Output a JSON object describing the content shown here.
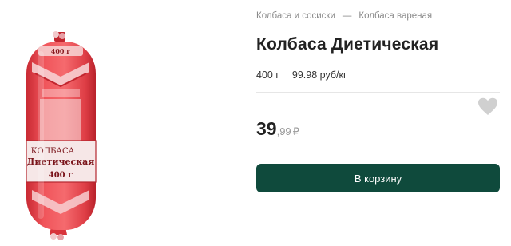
{
  "breadcrumb": {
    "items": [
      "Колбаса и сосиски",
      "Колбаса вареная"
    ],
    "separator": "—"
  },
  "product": {
    "title": "Колбаса Диетическая",
    "weight": "400 г",
    "unit_price": "99.98 руб/кг",
    "price_rub": "39",
    "price_kop": ",99",
    "currency": "₽",
    "image_label": {
      "weight_top": "400 г",
      "brand": "КОЛБАСА",
      "name": "Диетическая",
      "weight": "400 г"
    }
  },
  "actions": {
    "add_to_cart": "В корзину",
    "favorite_icon": "heart-icon"
  },
  "colors": {
    "accent": "#0f4a3c",
    "sausage": "#e8464d",
    "favorite": "#d0d0d0"
  }
}
